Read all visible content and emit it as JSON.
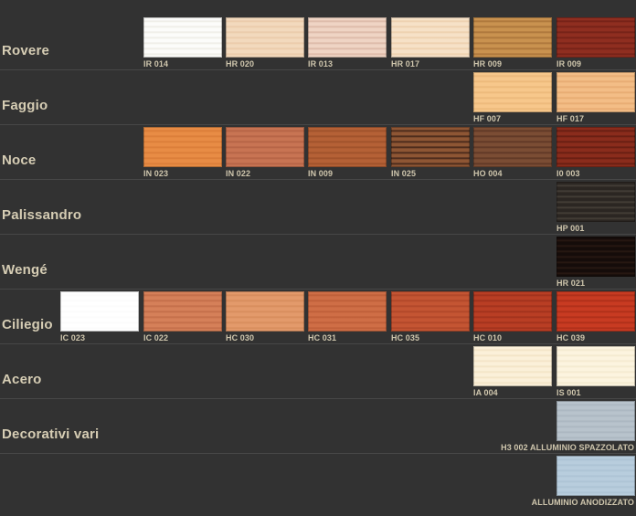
{
  "rows": [
    {
      "label": "Rovere",
      "swatches": [
        {
          "code": "IR 014",
          "col": 1,
          "bg": "#fcfcfa",
          "grain": "#eceae4"
        },
        {
          "code": "HR 020",
          "col": 2,
          "bg": "#f2d9bd",
          "grain": "#e8c8a6"
        },
        {
          "code": "IR 013",
          "col": 3,
          "bg": "#efd4c4",
          "grain": "#d9b4a2"
        },
        {
          "code": "HR 017",
          "col": 4,
          "bg": "#f6e1c7",
          "grain": "#ebcdaa"
        },
        {
          "code": "HR 009",
          "col": 5,
          "bg": "#c9924f",
          "grain": "#a67037"
        },
        {
          "code": "IR 009",
          "col": 6,
          "bg": "#8f2e20",
          "grain": "#6f1f15"
        }
      ]
    },
    {
      "label": "Faggio",
      "swatches": [
        {
          "code": "HF 007",
          "col": 5,
          "bg": "#f7c78b",
          "grain": "#eab577"
        },
        {
          "code": "HF 017",
          "col": 6,
          "bg": "#f3bd86",
          "grain": "#e4a86e"
        }
      ]
    },
    {
      "label": "Noce",
      "swatches": [
        {
          "code": "IN 023",
          "col": 1,
          "bg": "#e88c45",
          "grain": "#d87a36"
        },
        {
          "code": "IN 022",
          "col": 2,
          "bg": "#c87453",
          "grain": "#b26043"
        },
        {
          "code": "IN 009",
          "col": 3,
          "bg": "#b56136",
          "grain": "#9a4e29"
        },
        {
          "code": "IN 025",
          "col": 4,
          "bg": "#8e5634",
          "grain": "#3a2015"
        },
        {
          "code": "HO 004",
          "col": 5,
          "bg": "#7b4d34",
          "grain": "#5a3423"
        },
        {
          "code": "I0 003",
          "col": 6,
          "bg": "#8a2c1c",
          "grain": "#5f1b10"
        }
      ]
    },
    {
      "label": "Palissandro",
      "swatches": [
        {
          "code": "HP 001",
          "col": 6,
          "bg": "#2b2622",
          "grain": "#4a433c"
        }
      ]
    },
    {
      "label": "Wengé",
      "swatches": [
        {
          "code": "HR 021",
          "col": 6,
          "bg": "#150c0a",
          "grain": "#2c1a14"
        }
      ]
    },
    {
      "label": "Ciliegio",
      "swatches": [
        {
          "code": "IC 023",
          "col": 0,
          "bg": "#ffffff",
          "grain": "#fbfbfb"
        },
        {
          "code": "IC 022",
          "col": 1,
          "bg": "#d58059",
          "grain": "#c06b46"
        },
        {
          "code": "HC 030",
          "col": 2,
          "bg": "#e39a6b",
          "grain": "#d48a5a"
        },
        {
          "code": "HC 031",
          "col": 3,
          "bg": "#cf6e46",
          "grain": "#bb5b36"
        },
        {
          "code": "HC 035",
          "col": 4,
          "bg": "#c45533",
          "grain": "#ac4427"
        },
        {
          "code": "HC 010",
          "col": 5,
          "bg": "#b93e24",
          "grain": "#9c2f1a"
        },
        {
          "code": "HC 039",
          "col": 6,
          "bg": "#c83b22",
          "grain": "#a92c17"
        }
      ]
    },
    {
      "label": "Acero",
      "swatches": [
        {
          "code": "IA 004",
          "col": 5,
          "bg": "#fbf0d9",
          "grain": "#f1e2c3"
        },
        {
          "code": "IS 001",
          "col": 6,
          "bg": "#fcf4df",
          "grain": "#f2e8cc"
        }
      ]
    },
    {
      "label": "Decorativi vari",
      "swatches": [
        {
          "code": "H3 002 ALLUMINIO SPAZZOLATO",
          "col": 6,
          "bg": "#b8c3cc",
          "grain": "#a9b5bf",
          "right": true
        }
      ]
    },
    {
      "label": "",
      "swatches": [
        {
          "code": "ALLUMINIO ANODIZZATO",
          "col": 6,
          "bg": "#b8cddd",
          "grain": "#abc1d2",
          "right": true
        }
      ]
    }
  ]
}
